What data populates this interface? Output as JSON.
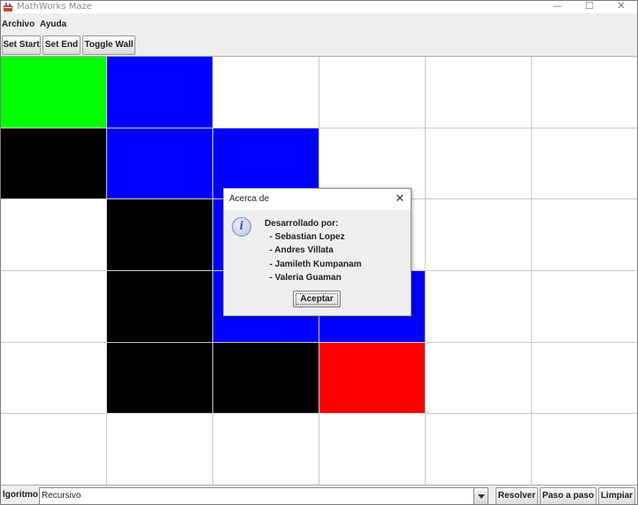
{
  "window": {
    "title": "MathWorks Maze",
    "controls": {
      "minimize": "—",
      "maximize": "☐",
      "close": "✕"
    }
  },
  "menu": [
    "Archivo",
    "Ayuda"
  ],
  "toolbar": {
    "set_start": "Set Start",
    "set_end": "Set End",
    "toggle_wall": "Toggle Wall"
  },
  "maze": {
    "rows": 6,
    "cols": 6,
    "colors": {
      "empty": "#ffffff",
      "wall": "#000000",
      "start": "#00ff00",
      "end": "#ff0000",
      "path": "#0000ff"
    },
    "cells": [
      [
        "start",
        "path",
        "empty",
        "empty",
        "empty",
        "empty"
      ],
      [
        "wall",
        "path",
        "path",
        "empty",
        "empty",
        "empty"
      ],
      [
        "empty",
        "wall",
        "path",
        "empty",
        "empty",
        "empty"
      ],
      [
        "empty",
        "wall",
        "path",
        "path",
        "empty",
        "empty"
      ],
      [
        "empty",
        "wall",
        "wall",
        "end",
        "empty",
        "empty"
      ],
      [
        "empty",
        "empty",
        "empty",
        "empty",
        "empty",
        "empty"
      ]
    ]
  },
  "about_dialog": {
    "title": "Acerca de",
    "close_glyph": "✕",
    "info_glyph": "i",
    "lines": [
      "Desarrollado por:",
      "  - Sebastian Lopez",
      "  - Andres Villata",
      "  - Jamileth Kumpanam",
      "  - Valeria Guaman"
    ],
    "ok_label": "Aceptar"
  },
  "bottom": {
    "algorithm_label": "lgoritmo:",
    "algorithm_value": "Recursivo",
    "solve": "Resolver",
    "step": "Paso a paso",
    "clear": "Limpiar"
  }
}
